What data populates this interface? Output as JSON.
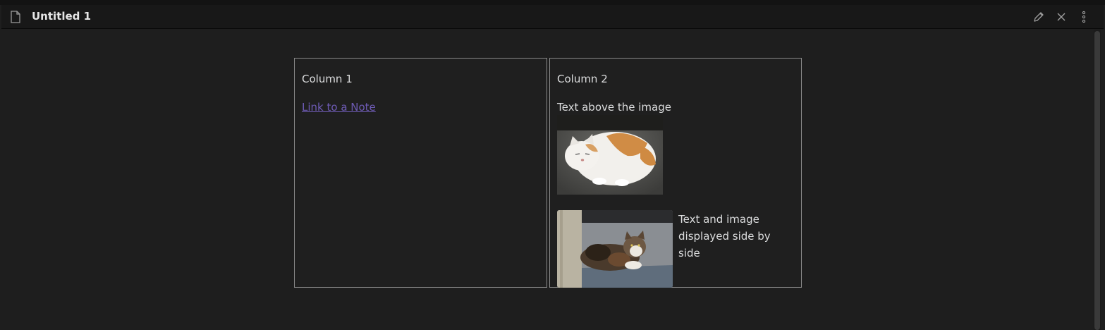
{
  "header": {
    "title": "Untitled 1",
    "icons": {
      "document": "file-icon",
      "edit": "pencil-icon",
      "close": "close-icon",
      "more": "more-vertical-icon"
    }
  },
  "columns": [
    {
      "title": "Column 1",
      "link_text": "Link to a Note"
    },
    {
      "title": "Column 2",
      "text_above_image": "Text above the image",
      "side_by_side_text": "Text and image displayed side by side"
    }
  ],
  "colors": {
    "background": "#1e1e1e",
    "header": "#181818",
    "border": "#8a8a8a",
    "link": "#6e5bb5",
    "text": "#dcddde"
  }
}
